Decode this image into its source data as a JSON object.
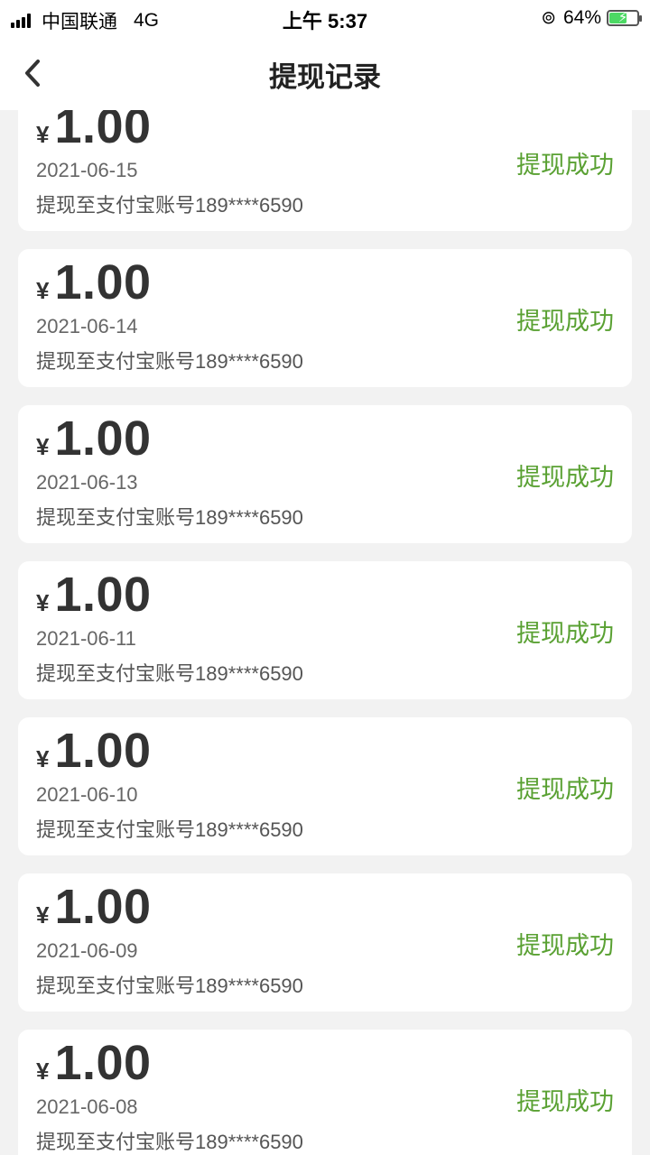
{
  "status_bar": {
    "carrier": "中国联通",
    "network": "4G",
    "time": "上午 5:37",
    "battery_text": "64%",
    "battery_level": 0.64,
    "orientation_lock_icon": "orientation-lock-icon",
    "signal_icon": "signal-icon"
  },
  "nav": {
    "back_icon": "chevron-left-icon",
    "title": "提现记录"
  },
  "colors": {
    "success": "#5aa133",
    "background": "#f2f2f2",
    "card": "#ffffff"
  },
  "records": [
    {
      "currency": "¥",
      "amount": "1.00",
      "date": "2021-06-15",
      "desc": "提现至支付宝账号189****6590",
      "status": "提现成功"
    },
    {
      "currency": "¥",
      "amount": "1.00",
      "date": "2021-06-14",
      "desc": "提现至支付宝账号189****6590",
      "status": "提现成功"
    },
    {
      "currency": "¥",
      "amount": "1.00",
      "date": "2021-06-13",
      "desc": "提现至支付宝账号189****6590",
      "status": "提现成功"
    },
    {
      "currency": "¥",
      "amount": "1.00",
      "date": "2021-06-11",
      "desc": "提现至支付宝账号189****6590",
      "status": "提现成功"
    },
    {
      "currency": "¥",
      "amount": "1.00",
      "date": "2021-06-10",
      "desc": "提现至支付宝账号189****6590",
      "status": "提现成功"
    },
    {
      "currency": "¥",
      "amount": "1.00",
      "date": "2021-06-09",
      "desc": "提现至支付宝账号189****6590",
      "status": "提现成功"
    },
    {
      "currency": "¥",
      "amount": "1.00",
      "date": "2021-06-08",
      "desc": "提现至支付宝账号189****6590",
      "status": "提现成功"
    }
  ]
}
